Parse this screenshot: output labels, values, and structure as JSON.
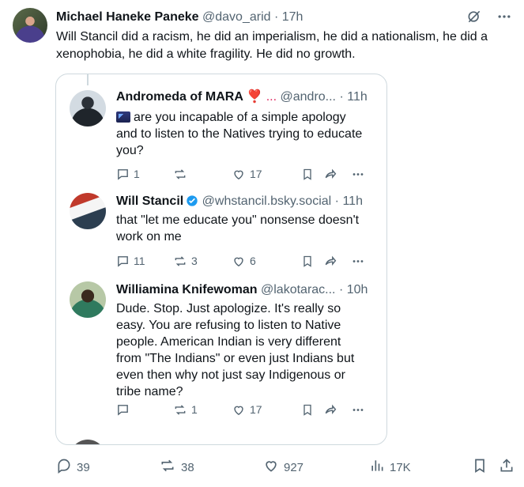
{
  "post": {
    "author_name": "Michael Haneke Paneke",
    "author_handle": "@davo_arid",
    "dot": "·",
    "time": "17h",
    "text": "Will Stancil did a racism, he did an imperialism, he did a nationalism, he did a xenophobia, he did a white fragility. He did no growth.",
    "icons": [
      "grok-icon",
      "more-icon"
    ],
    "stats": {
      "replies": "39",
      "reposts": "38",
      "likes": "927",
      "views": "17K"
    }
  },
  "quote": {
    "replies": [
      {
        "name": "Andromeda of MARA",
        "emoji": "❣️ ...",
        "handle": "@andro...",
        "dot": "·",
        "time": "11h",
        "text": "are you incapable of a simple apology and to listen to the Natives trying to educate you?",
        "replies": "1",
        "reposts": "",
        "likes": "17"
      },
      {
        "name": "Will Stancil",
        "handle": "@whstancil.bsky.social",
        "dot": "·",
        "time": "11h",
        "text": "that \"let me educate you\" nonsense doesn't work on me",
        "replies": "11",
        "reposts": "3",
        "likes": "6"
      },
      {
        "name": "Williamina Knifewoman",
        "handle": "@lakotarac...",
        "dot": "·",
        "time": "10h",
        "text": "Dude. Stop. Just apologize. It's really so easy.  You are refusing to listen to Native people. American Indian is very different from \"The Indians\" or even just Indians but even then why not just say Indigenous or tribe name?",
        "replies": "",
        "reposts": "1",
        "likes": "17"
      }
    ]
  },
  "colors": {
    "text": "#0f1419",
    "muted": "#536471",
    "border": "#cfd9de",
    "verified": "#1d9bf0"
  }
}
